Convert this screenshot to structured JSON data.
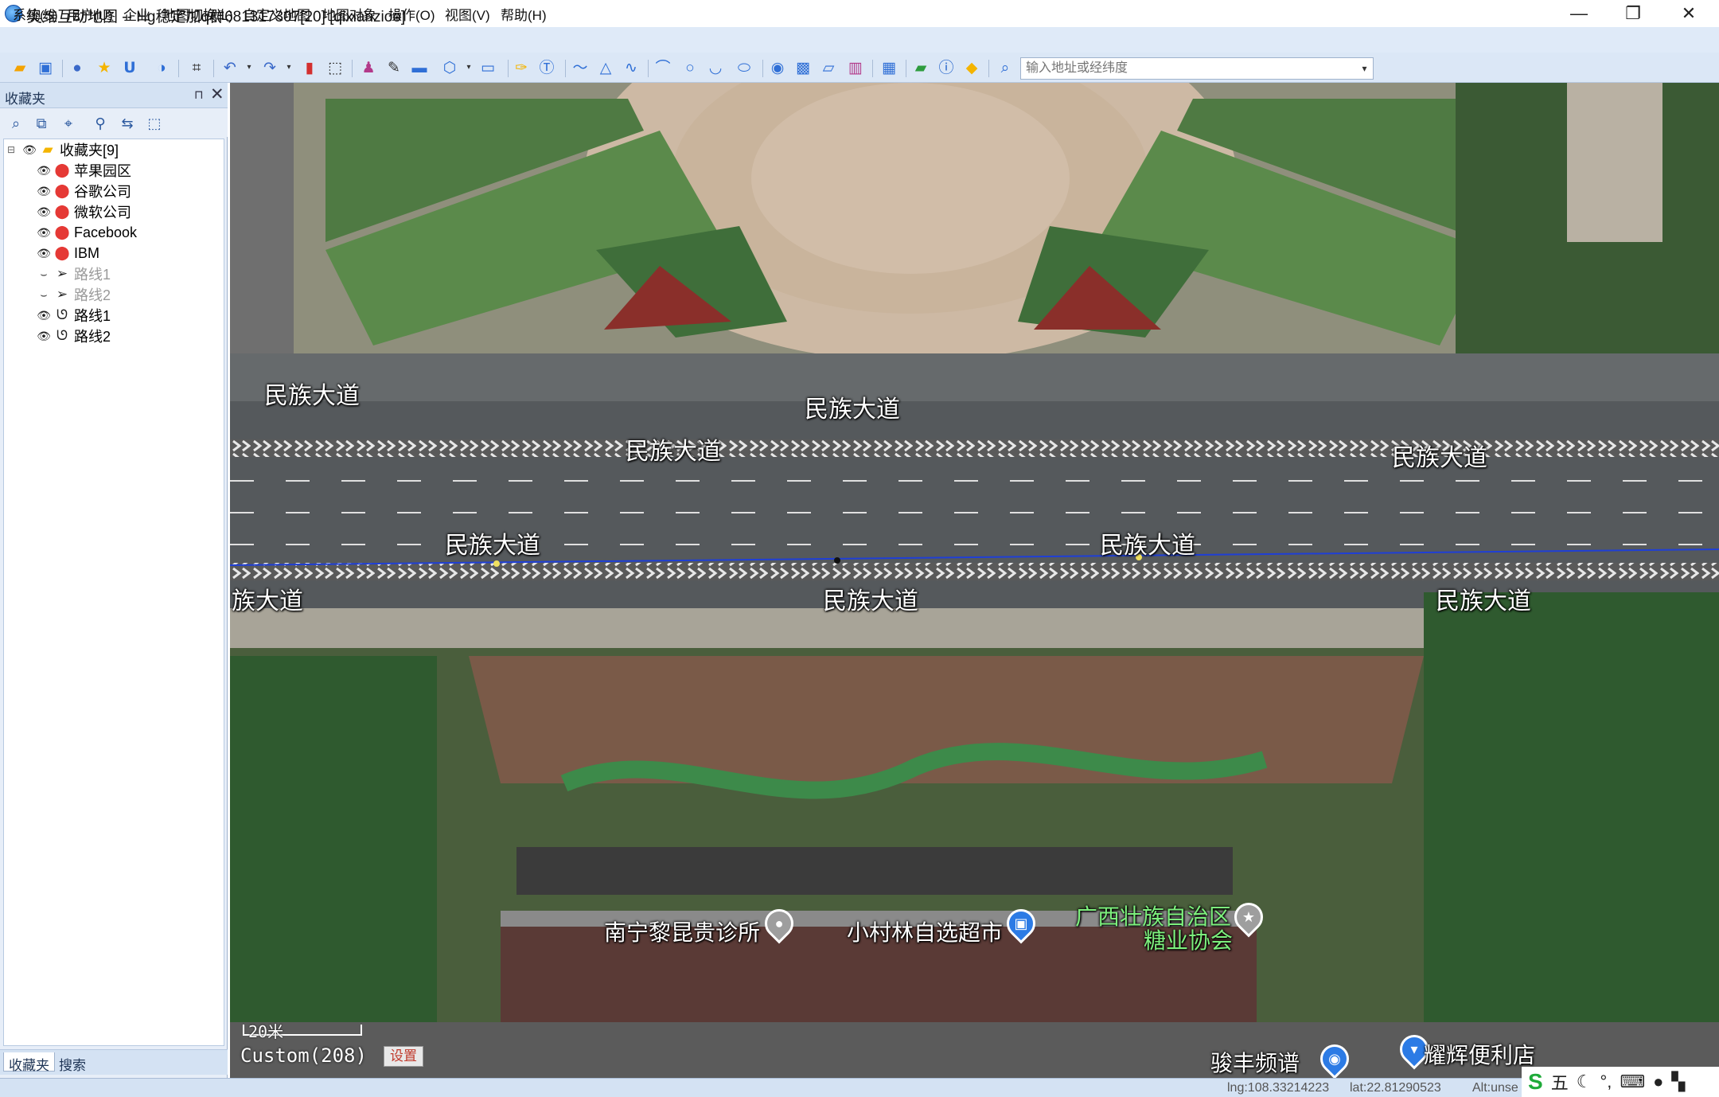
{
  "window": {
    "title": "奥维互动地图 -- Hg稳定加q群681317307[20] [qixianzioo]",
    "minimize_icon": "—",
    "restore_icon": "❐",
    "close_icon": "✕"
  },
  "menu": [
    "系统(S)",
    "用户(U)",
    "企业",
    "地图切换(L)",
    "自定义地图",
    "地图对象",
    "操作(O)",
    "视图(V)",
    "帮助(H)"
  ],
  "toolbar": {
    "search_placeholder": "输入地址或经纬度"
  },
  "panel": {
    "title": "收藏夹",
    "pin_icon": "⊓",
    "close_icon": "✕",
    "tree": {
      "root_label": "收藏夹[9]",
      "items": [
        {
          "label": "苹果园区",
          "type": "marker",
          "visible": true
        },
        {
          "label": "谷歌公司",
          "type": "marker",
          "visible": true
        },
        {
          "label": "微软公司",
          "type": "marker",
          "visible": true
        },
        {
          "label": "Facebook",
          "type": "marker",
          "visible": true
        },
        {
          "label": "IBM",
          "type": "marker",
          "visible": true
        },
        {
          "label": "路线1",
          "type": "navigation",
          "visible": false
        },
        {
          "label": "路线2",
          "type": "navigation",
          "visible": false
        },
        {
          "label": "路线1",
          "type": "track",
          "visible": true
        },
        {
          "label": "路线2",
          "type": "track",
          "visible": true
        }
      ]
    },
    "tabs": [
      "收藏夹",
      "搜索"
    ]
  },
  "map": {
    "road_name": "民族大道",
    "road_name_cut": "族大道",
    "pois": {
      "clinic": "南宁黎昆贵诊所",
      "supermarket": "小村林自选超市",
      "assoc_line1": "广西壮族自治区",
      "assoc_line2": "糖业协会",
      "music": "骏丰频谱",
      "store": "耀辉便利店"
    },
    "scale_label": "20米",
    "zoom_label": "Custom(208)",
    "settings_label": "设置"
  },
  "status": {
    "lng": "lng:108.33214223",
    "lat": "lat:22.81290523",
    "alt": "Alt:unse"
  },
  "ime": {
    "logo": "S",
    "mode": "五"
  },
  "colors": {
    "menubar": "#dfeaf8",
    "toolbar": "#dbe7f6",
    "route_line": "#1f3fd6",
    "marker_red": "#e53935"
  }
}
